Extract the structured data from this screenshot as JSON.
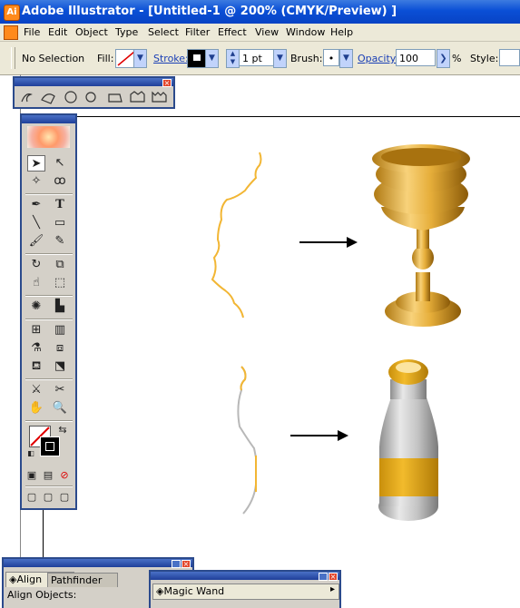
{
  "app": {
    "title": "Adobe Illustrator - [Untitled-1 @ 200% (CMYK/Preview) ]",
    "icon": "Ai"
  },
  "menu": [
    "File",
    "Edit",
    "Object",
    "Type",
    "Select",
    "Filter",
    "Effect",
    "View",
    "Window",
    "Help"
  ],
  "control": {
    "selection": "No Selection",
    "fill_label": "Fill:",
    "stroke_label": "Stroke:",
    "stroke_weight": "1 pt",
    "brush_label": "Brush:",
    "brush_value": "•",
    "opacity_label": "Opacity:",
    "opacity_value": "100",
    "percent": "%",
    "style_label": "Style:"
  },
  "panels": {
    "align_tab": "Align",
    "pathfinder_tab": "Pathfinder",
    "align_objects": "Align Objects:",
    "magic_wand": "Magic Wand"
  },
  "colors": {
    "gold": "#e3a92e",
    "gray": "#b8b8b8",
    "title_blue": "#0a4fd6"
  }
}
